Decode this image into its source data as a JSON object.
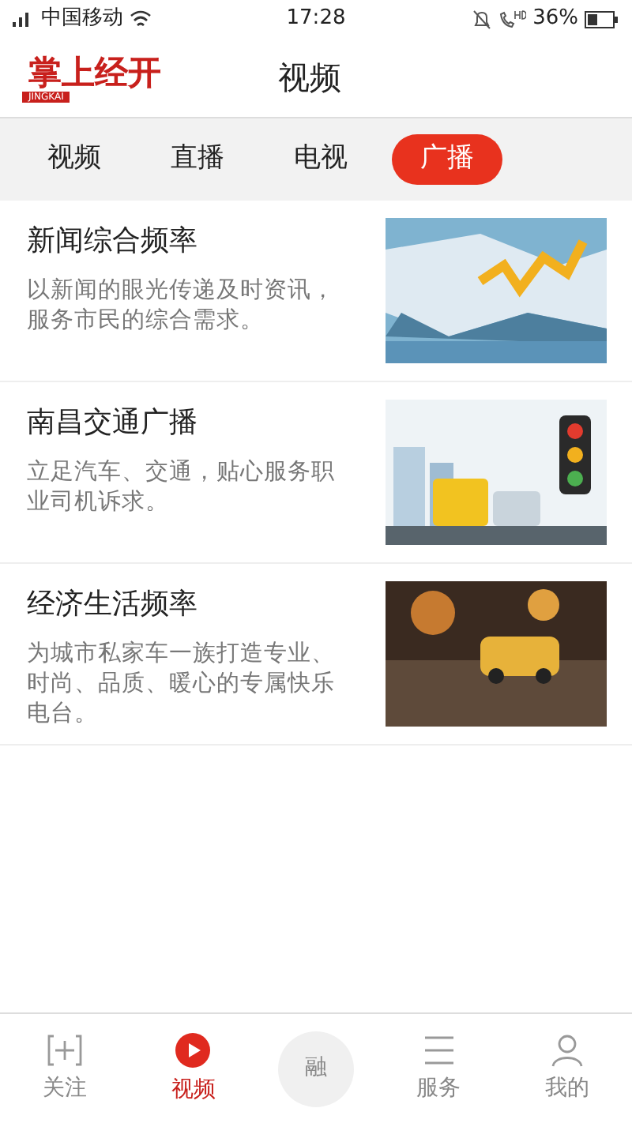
{
  "status_bar": {
    "carrier": "中国移动",
    "time": "17:28",
    "battery": "36%"
  },
  "header": {
    "logo": "掌上经开",
    "logo_sub": "JINGKAI",
    "title": "视频"
  },
  "tabs": [
    {
      "label": "视频",
      "selected": false
    },
    {
      "label": "直播",
      "selected": false
    },
    {
      "label": "电视",
      "selected": false
    },
    {
      "label": "广播",
      "selected": true
    }
  ],
  "channels": [
    {
      "name": "新闻综合频率",
      "description": "以新闻的眼光传递及时资讯，服务市民的综合需求。",
      "kind": "picture"
    },
    {
      "name": "南昌交通广播",
      "description": "立足汽车、交通，贴心服务职业司机诉求。",
      "kind": "picture"
    },
    {
      "name": "经济生活频率",
      "description": "为城市私家车一族打造专业、时尚、品质、暖心的专属快乐电台。",
      "kind": "picture"
    }
  ],
  "bottom_nav": [
    {
      "label": "关注",
      "kind": "plus",
      "selected": false
    },
    {
      "label": "视频",
      "kind": "play",
      "selected": true
    },
    {
      "label": "融",
      "kind": "circle",
      "selected": false
    },
    {
      "label": "服务",
      "kind": "list",
      "selected": false
    },
    {
      "label": "我的",
      "kind": "user",
      "selected": false
    }
  ]
}
